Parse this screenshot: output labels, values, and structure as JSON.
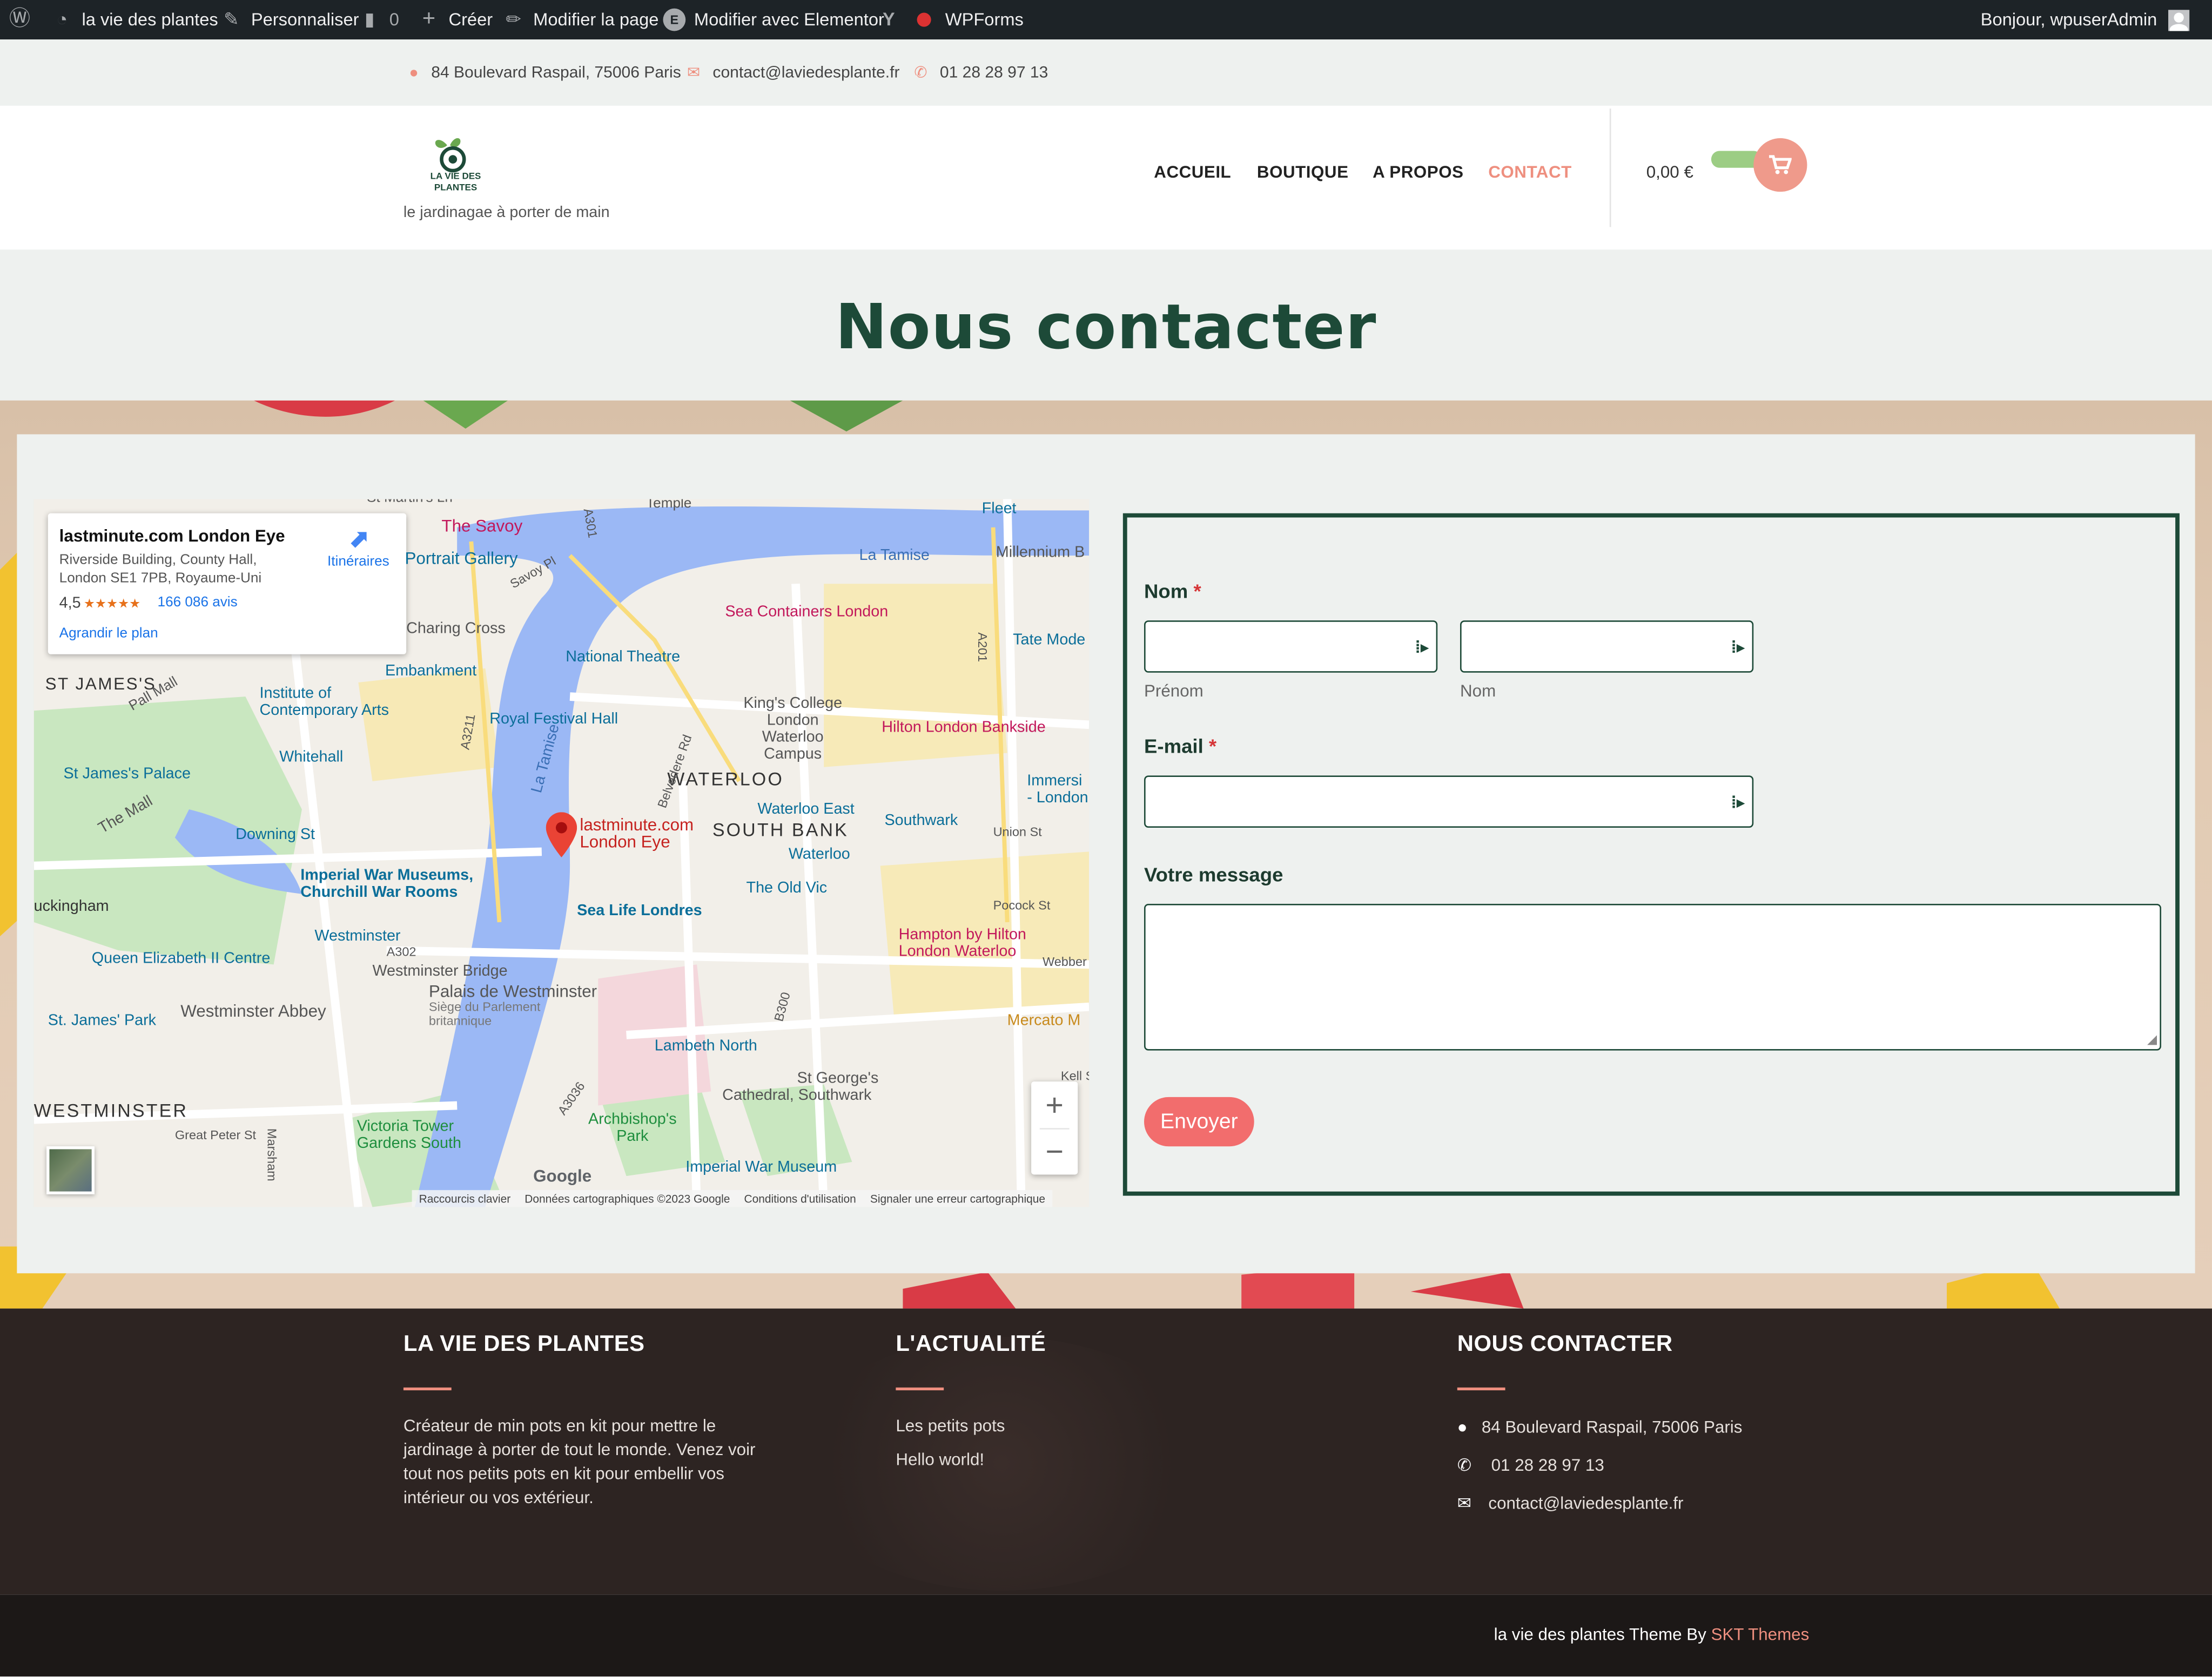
{
  "admin_bar": {
    "site_name": "la vie des plantes",
    "customize": "Personnaliser",
    "comments_count": "0",
    "new": "Créer",
    "edit_page": "Modifier la page",
    "edit_elementor": "Modifier avec Elementor",
    "wpforms": "WPForms",
    "greeting": "Bonjour, wpuserAdmin"
  },
  "topbar": {
    "address": "84 Boulevard Raspail, 75006 Paris",
    "email": "contact@laviedesplante.fr",
    "phone": "01 28 28 97 13"
  },
  "header": {
    "logo_line1": "LA VIE DES",
    "logo_line2": "PLANTES",
    "tagline": "le jardinagae à porter de main",
    "nav": [
      "ACCUEIL",
      "BOUTIQUE",
      "A PROPOS",
      "CONTACT"
    ],
    "active_nav": "CONTACT",
    "cart_total": "0,00 €"
  },
  "hero": {
    "title": "Nous contacter"
  },
  "map": {
    "card_title": "lastminute.com London Eye",
    "card_address_1": "Riverside Building, County Hall,",
    "card_address_2": "London SE1 7PB, Royaume-Uni",
    "rating": "4,5",
    "stars": "★★★★★",
    "reviews": "166 086 avis",
    "enlarge": "Agrandir le plan",
    "directions": "Itinéraires",
    "pin_label_1": "lastminute.com",
    "pin_label_2": "London Eye",
    "labels": [
      "The Savoy",
      "Portrait Gallery",
      "La Tamise",
      "Millennium B",
      "Sea Containers London",
      "Charing Cross",
      "National Theatre",
      "Tate Mode",
      "Embankment",
      "ST JAMES'S",
      "Institute of",
      "Contemporary Arts",
      "King's College",
      "London",
      "Waterloo",
      "Campus",
      "Royal Festival Hall",
      "Hilton London Bankside",
      "Whitehall",
      "St James's Palace",
      "WATERLOO",
      "Immersi",
      "- London",
      "Waterloo East",
      "Southwark",
      "The Mall",
      "SOUTH BANK",
      "Downing St",
      "Waterloo",
      "Imperial War Museums,",
      "Churchill War Rooms",
      "The Old Vic",
      "Sea Life Londres",
      "uckingham",
      "Hampton by Hilton",
      "London Waterloo",
      "Westminster",
      "Queen Elizabeth II Centre",
      "Westminster Bridge",
      "Palais de Westminster",
      "Siège du Parlement",
      "britannique",
      "Westminster Abbey",
      "St. James' Park",
      "Mercato M",
      "Lambeth North",
      "WESTMINSTER",
      "St George's",
      "Cathedral, Southwark",
      "Archbishop's",
      "Park",
      "Victoria Tower",
      "Gardens South",
      "Imperial War Museum",
      "La Tamise",
      "A3211",
      "A302",
      "B300",
      "A3036",
      "A201",
      "A301",
      "Fleet",
      "Pall Mall",
      "Savoy Pl",
      "Belvedere Rd",
      "Union St",
      "Great Peter St",
      "Pocock St",
      "Webber",
      "Kell S",
      "Marsham",
      "Temple",
      "St Martin's Ln"
    ],
    "google": "Google",
    "footer_links": [
      "Raccourcis clavier",
      "Données cartographiques ©2023 Google",
      "Conditions d'utilisation",
      "Signaler une erreur cartographique"
    ],
    "zoom_in": "+",
    "zoom_out": "−"
  },
  "form": {
    "name_label": "Nom",
    "required_mark": "*",
    "first_sub": "Prénom",
    "last_sub": "Nom",
    "email_label": "E-mail",
    "message_label": "Votre message",
    "submit": "Envoyer"
  },
  "footer": {
    "col1_title": "LA VIE DES PLANTES",
    "col1_text": "Créateur de min pots en kit pour mettre le jardinage à porter de tout le monde. Venez voir tout nos petits pots en kit pour embellir vos intérieur ou vos extérieur.",
    "col2_title": "L'ACTUALITÉ",
    "col2_links": [
      "Les petits pots",
      "Hello world!"
    ],
    "col3_title": "NOUS CONTACTER",
    "address": "84 Boulevard Raspail, 75006 Paris",
    "phone": "01 28 28 97 13",
    "email": "contact@laviedesplante.fr",
    "copyright_text": "la vie des plantes Theme By",
    "copyright_link": "SKT Themes"
  },
  "colors": {
    "primary_green": "#1d4a38",
    "accent_salmon": "#ee8f7f",
    "button_red": "#f26d6d",
    "map_water": "#9bb8f5"
  }
}
